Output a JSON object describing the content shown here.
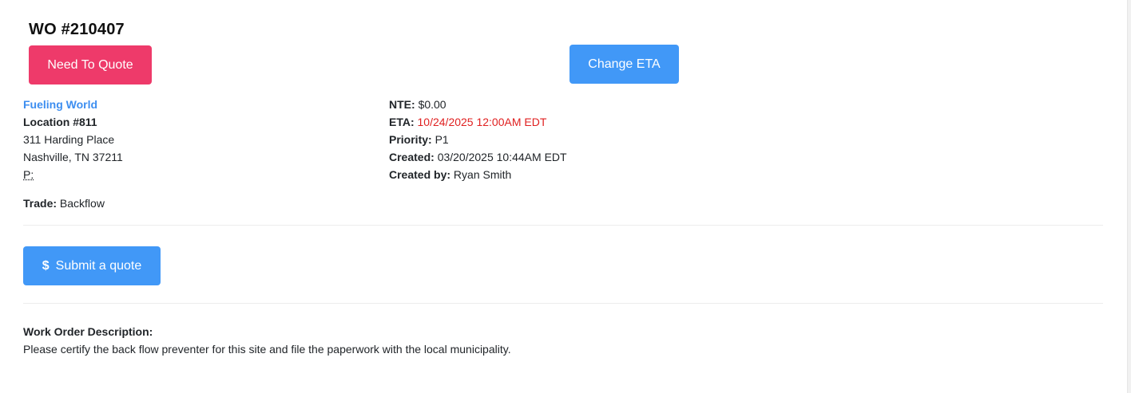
{
  "work_order": {
    "title": "WO #210407",
    "status_button": "Need To Quote",
    "change_eta_button": "Change ETA"
  },
  "location": {
    "customer_name": "Fueling World",
    "location_label": "Location #811",
    "address_line1": "311 Harding Place",
    "address_line2": "Nashville, TN 37211",
    "phone_label": "P:",
    "phone_value": "",
    "trade_label": "Trade:",
    "trade_value": "Backflow"
  },
  "details": {
    "nte_label": "NTE:",
    "nte_value": "$0.00",
    "eta_label": "ETA:",
    "eta_value": "10/24/2025 12:00AM EDT",
    "priority_label": "Priority:",
    "priority_value": "P1",
    "created_label": "Created:",
    "created_value": "03/20/2025 10:44AM EDT",
    "created_by_label": "Created by:",
    "created_by_value": "Ryan Smith"
  },
  "actions": {
    "submit_quote_icon": "$",
    "submit_quote_label": "Submit a quote"
  },
  "description": {
    "label": "Work Order Description:",
    "text": "Please certify the back flow preventer for this site and file the paperwork with the local municipality."
  },
  "colors": {
    "status_button": "#ee3a6a",
    "primary_button": "#4198f7",
    "link": "#3d8ef0",
    "eta_overdue": "#e02020"
  }
}
